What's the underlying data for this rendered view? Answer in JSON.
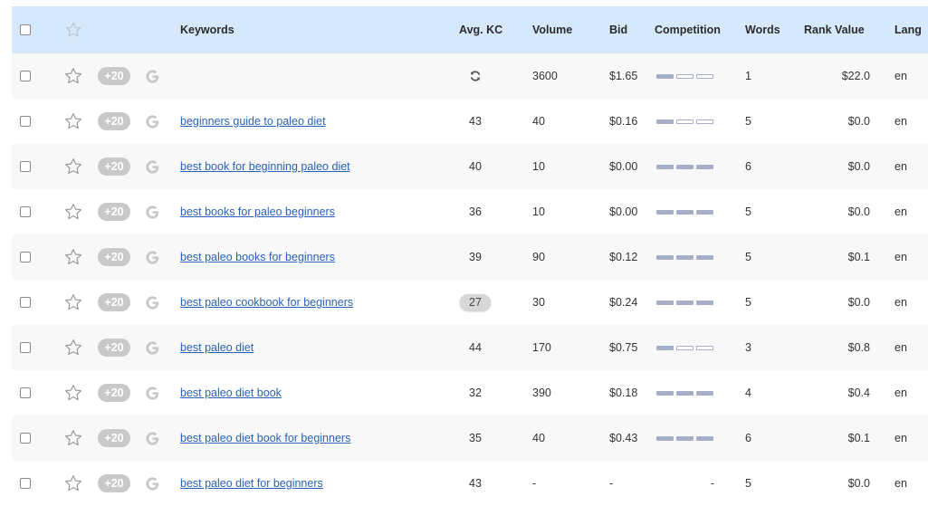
{
  "header": {
    "keywords": "Keywords",
    "avg_kc": "Avg. KC",
    "volume": "Volume",
    "bid": "Bid",
    "competition": "Competition",
    "words": "Words",
    "rank_value": "Rank Value",
    "lang": "Lang"
  },
  "badge_label": "+20",
  "rows": [
    {
      "keyword": "",
      "kc": "",
      "kc_loading": true,
      "volume": "3600",
      "bid": "$1.65",
      "competition": 1,
      "words": "1",
      "rank_value": "$22.0",
      "lang": "en"
    },
    {
      "keyword": "beginners guide to paleo diet",
      "kc": "43",
      "volume": "40",
      "bid": "$0.16",
      "competition": 1,
      "words": "5",
      "rank_value": "$0.0",
      "lang": "en"
    },
    {
      "keyword": "best book for beginning paleo diet",
      "kc": "40",
      "volume": "10",
      "bid": "$0.00",
      "competition": 3,
      "words": "6",
      "rank_value": "$0.0",
      "lang": "en"
    },
    {
      "keyword": "best books for paleo beginners",
      "kc": "36",
      "volume": "10",
      "bid": "$0.00",
      "competition": 3,
      "words": "5",
      "rank_value": "$0.0",
      "lang": "en"
    },
    {
      "keyword": "best paleo books for beginners",
      "kc": "39",
      "volume": "90",
      "bid": "$0.12",
      "competition": 3,
      "words": "5",
      "rank_value": "$0.1",
      "lang": "en"
    },
    {
      "keyword": "best paleo cookbook for beginners",
      "kc": "27",
      "kc_highlight": true,
      "volume": "30",
      "bid": "$0.24",
      "competition": 3,
      "words": "5",
      "rank_value": "$0.0",
      "lang": "en"
    },
    {
      "keyword": "best paleo diet",
      "kc": "44",
      "volume": "170",
      "bid": "$0.75",
      "competition": 1,
      "words": "3",
      "rank_value": "$0.8",
      "lang": "en"
    },
    {
      "keyword": "best paleo diet book",
      "kc": "32",
      "volume": "390",
      "bid": "$0.18",
      "competition": 3,
      "words": "4",
      "rank_value": "$0.4",
      "lang": "en"
    },
    {
      "keyword": "best paleo diet book for beginners",
      "kc": "35",
      "volume": "40",
      "bid": "$0.43",
      "competition": 3,
      "words": "6",
      "rank_value": "$0.1",
      "lang": "en"
    },
    {
      "keyword": "best paleo diet for beginners",
      "kc": "43",
      "volume": "-",
      "bid": "-",
      "competition": null,
      "competition_text": "-",
      "words": "5",
      "rank_value": "$0.0",
      "lang": "en"
    }
  ]
}
